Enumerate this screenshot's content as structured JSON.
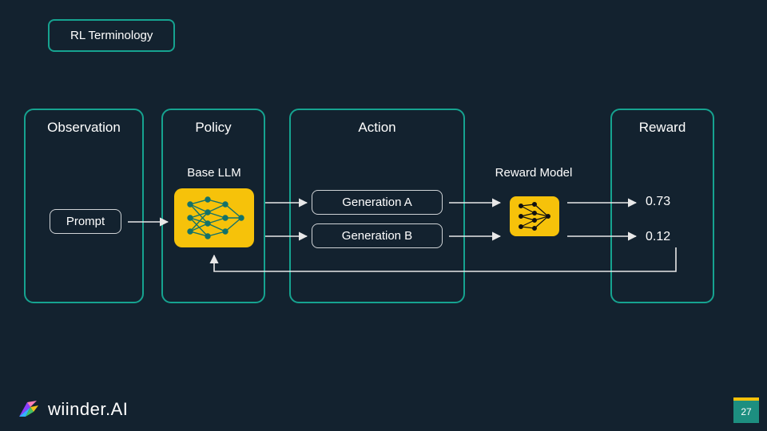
{
  "title_tag": "RL Terminology",
  "panels": {
    "observation": {
      "title": "Observation",
      "item": "Prompt"
    },
    "policy": {
      "title": "Policy",
      "sub": "Base LLM"
    },
    "action": {
      "title": "Action",
      "genA": "Generation A",
      "genB": "Generation B"
    },
    "reward_model_label": "Reward Model",
    "reward": {
      "title": "Reward",
      "a": "0.73",
      "b": "0.12"
    }
  },
  "logo": "wiinder.AI",
  "page_number": "27",
  "chart_data": {
    "type": "diagram",
    "title": "RL Terminology",
    "nodes": [
      {
        "id": "prompt",
        "label": "Prompt",
        "group": "Observation"
      },
      {
        "id": "base_llm",
        "label": "Base LLM",
        "group": "Policy"
      },
      {
        "id": "gen_a",
        "label": "Generation A",
        "group": "Action"
      },
      {
        "id": "gen_b",
        "label": "Generation B",
        "group": "Action"
      },
      {
        "id": "reward_model",
        "label": "Reward Model",
        "group": ""
      },
      {
        "id": "reward_a",
        "label": "0.73",
        "group": "Reward"
      },
      {
        "id": "reward_b",
        "label": "0.12",
        "group": "Reward"
      }
    ],
    "edges": [
      {
        "from": "prompt",
        "to": "base_llm"
      },
      {
        "from": "base_llm",
        "to": "gen_a"
      },
      {
        "from": "base_llm",
        "to": "gen_b"
      },
      {
        "from": "gen_a",
        "to": "reward_model"
      },
      {
        "from": "gen_b",
        "to": "reward_model"
      },
      {
        "from": "reward_model",
        "to": "reward_a"
      },
      {
        "from": "reward_model",
        "to": "reward_b"
      },
      {
        "from": "reward_b",
        "to": "base_llm",
        "note": "feedback"
      }
    ],
    "groups": [
      "Observation",
      "Policy",
      "Action",
      "Reward"
    ]
  }
}
